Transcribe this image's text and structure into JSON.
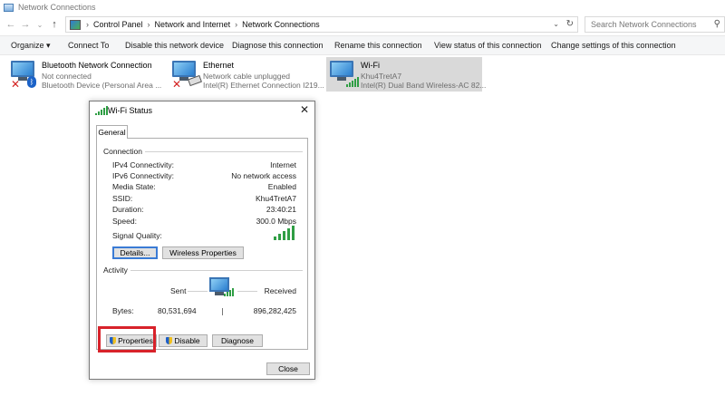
{
  "window": {
    "title": "Network Connections"
  },
  "address_bar": {
    "crumbs": [
      "Control Panel",
      "Network and Internet",
      "Network Connections"
    ],
    "search_placeholder": "Search Network Connections"
  },
  "commands": {
    "organize": "Organize ▾",
    "connect_to": "Connect To",
    "disable": "Disable this network device",
    "diagnose": "Diagnose this connection",
    "rename": "Rename this connection",
    "view_status": "View status of this connection",
    "change_settings": "Change settings of this connection"
  },
  "connections": [
    {
      "name": "Bluetooth Network Connection",
      "status": "Not connected",
      "device": "Bluetooth Device (Personal Area ..."
    },
    {
      "name": "Ethernet",
      "status": "Network cable unplugged",
      "device": "Intel(R) Ethernet Connection I219..."
    },
    {
      "name": "Wi-Fi",
      "status": "Khu4TretA7",
      "device": "Intel(R) Dual Band Wireless-AC 82..."
    }
  ],
  "dialog": {
    "title": "Wi-Fi Status",
    "tab": "General",
    "connection_group": "Connection",
    "rows": [
      {
        "label": "IPv4 Connectivity:",
        "value": "Internet"
      },
      {
        "label": "IPv6 Connectivity:",
        "value": "No network access"
      },
      {
        "label": "Media State:",
        "value": "Enabled"
      },
      {
        "label": "SSID:",
        "value": "Khu4TretA7"
      },
      {
        "label": "Duration:",
        "value": "23:40:21"
      },
      {
        "label": "Speed:",
        "value": "300.0 Mbps"
      }
    ],
    "signal_quality_label": "Signal Quality:",
    "details_button": "Details...",
    "wireless_properties_button": "Wireless Properties",
    "activity_group": "Activity",
    "sent_label": "Sent",
    "received_label": "Received",
    "bytes_label": "Bytes:",
    "bytes_sent": "80,531,694",
    "bytes_received": "896,282,425",
    "properties_button": "Properties",
    "disable_button": "Disable",
    "diagnose_button": "Diagnose",
    "close_button": "Close"
  },
  "colors": {
    "highlight": "#d8222a",
    "selected_bg": "#d9d9d9",
    "signal": "#2f9e44"
  }
}
